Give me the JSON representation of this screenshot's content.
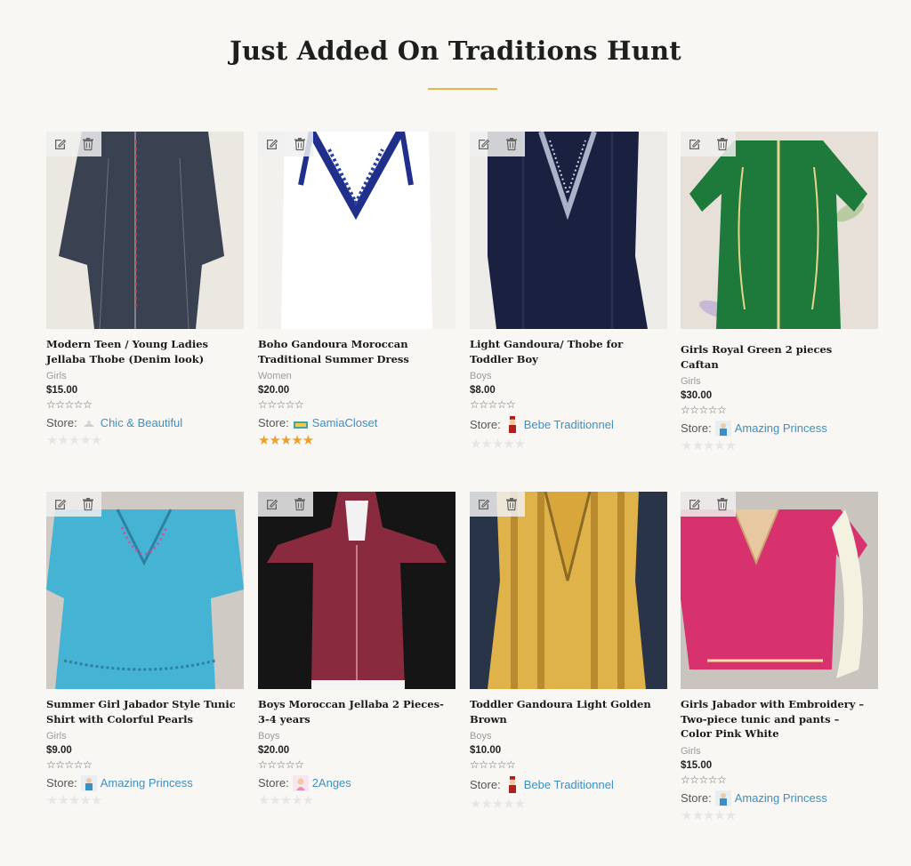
{
  "page": {
    "title": "Just Added On Traditions Hunt",
    "accent_color": "#e5b64b",
    "link_color": "#3f8fc0"
  },
  "store_prefix": "Store:",
  "products": [
    {
      "name": "Modern Teen / Young Ladies Jellaba Thobe (Denim look)",
      "category": "Girls",
      "price": "$15.00",
      "store": "Chic & Beautiful",
      "store_rating": 0
    },
    {
      "name": "Boho Gandoura Moroccan Traditional Summer Dress",
      "category": "Women",
      "price": "$20.00",
      "store": "SamiaCloset",
      "store_rating": 5
    },
    {
      "name": "Light Gandoura/ Thobe for Toddler Boy",
      "category": "Boys",
      "price": "$8.00",
      "store": "Bebe Traditionnel",
      "store_rating": 0
    },
    {
      "name": "Girls Royal Green 2 pieces Caftan",
      "category": "Girls",
      "price": "$30.00",
      "store": "Amazing Princess",
      "store_rating": 0
    },
    {
      "name": "Summer Girl Jabador Style Tunic Shirt with Colorful Pearls",
      "category": "Girls",
      "price": "$9.00",
      "store": "Amazing Princess",
      "store_rating": 0
    },
    {
      "name": "Boys Moroccan Jellaba 2 Pieces- 3-4 years",
      "category": "Boys",
      "price": "$20.00",
      "store": "2Anges",
      "store_rating": 0
    },
    {
      "name": "Toddler Gandoura Light Golden Brown",
      "category": "Boys",
      "price": "$10.00",
      "store": "Bebe Traditionnel",
      "store_rating": 0
    },
    {
      "name": "Girls Jabador with Embroidery – Two-piece tunic and pants – Color Pink White",
      "category": "Girls",
      "price": "$15.00",
      "store": "Amazing Princess",
      "store_rating": 0
    }
  ]
}
